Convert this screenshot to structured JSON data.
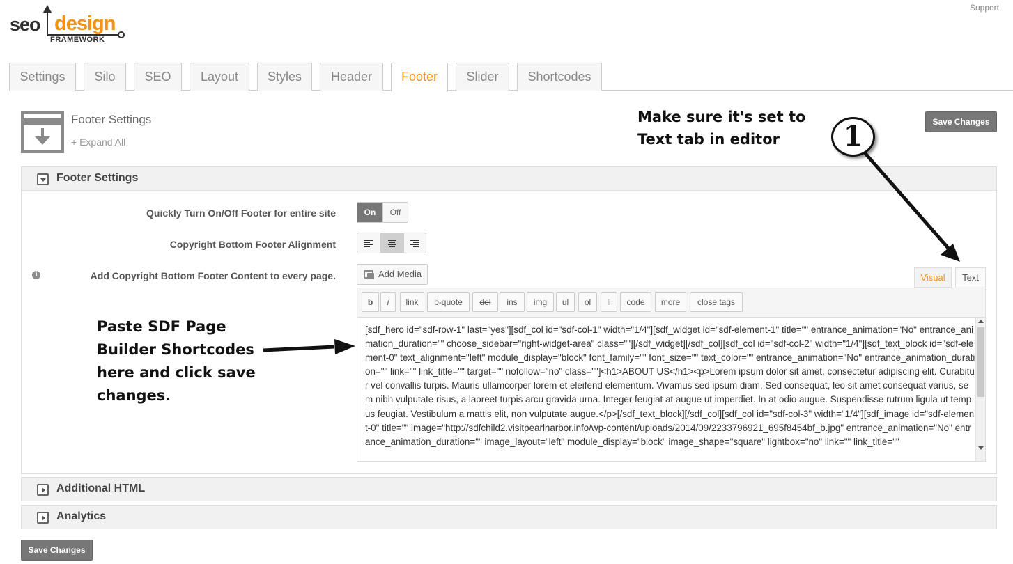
{
  "logo": {
    "seo": "seo",
    "design": "design",
    "framework": "FRAMEWORK"
  },
  "support": "Support",
  "tabs": [
    "Settings",
    "Silo",
    "SEO",
    "Layout",
    "Styles",
    "Header",
    "Footer",
    "Slider",
    "Shortcodes"
  ],
  "active_tab": "Footer",
  "page": {
    "title": "Footer Settings",
    "expand_all": "+ Expand All",
    "save_label": "Save Changes"
  },
  "panels": {
    "footer": {
      "title": "Footer Settings"
    },
    "additional_html": {
      "title": "Additional HTML"
    },
    "analytics": {
      "title": "Analytics"
    }
  },
  "fields": {
    "toggle_footer": {
      "label": "Quickly Turn On/Off Footer for entire site",
      "on": "On",
      "off": "Off",
      "value": "On"
    },
    "alignment": {
      "label": "Copyright Bottom Footer Alignment",
      "value": "center"
    },
    "content": {
      "label": "Add Copyright Bottom Footer Content to every page.",
      "info_icon": "i"
    }
  },
  "editor": {
    "add_media": "Add Media",
    "tab_visual": "Visual",
    "tab_text": "Text",
    "active_tab": "Text",
    "quicktags": [
      "b",
      "i",
      "link",
      "b-quote",
      "del",
      "ins",
      "img",
      "ul",
      "ol",
      "li",
      "code",
      "more",
      "close tags"
    ],
    "content": "[sdf_hero id=\"sdf-row-1\" last=\"yes\"][sdf_col id=\"sdf-col-1\" width=\"1/4\"][sdf_widget id=\"sdf-element-1\" title=\"\" entrance_animation=\"No\" entrance_animation_duration=\"\" choose_sidebar=\"right-widget-area\" class=\"\"][/sdf_widget][/sdf_col][sdf_col id=\"sdf-col-2\" width=\"1/4\"][sdf_text_block id=\"sdf-element-0\" text_alignment=\"left\" module_display=\"block\" font_family=\"\" font_size=\"\" text_color=\"\" entrance_animation=\"No\" entrance_animation_duration=\"\" link=\"\" link_title=\"\" target=\"\" nofollow=\"no\" class=\"\"]<h1>ABOUT US</h1><p>Lorem ipsum dolor sit amet, consectetur adipiscing elit. Curabitur vel convallis turpis. Mauris ullamcorper lorem et eleifend elementum. Vivamus sed ipsum diam. Sed consequat, leo sit amet consequat varius, sem nibh vulputate risus, a laoreet turpis arcu gravida urna. Integer feugiat at augue ut imperdiet. In at odio augue. Suspendisse rutrum ligula ut tempus feugiat. Vestibulum a mattis elit, non vulputate augue.</p>[/sdf_text_block][/sdf_col][sdf_col id=\"sdf-col-3\" width=\"1/4\"][sdf_image id=\"sdf-element-0\" title=\"\" image=\"http://sdfchild2.visitpearlharbor.info/wp-content/uploads/2014/09/2233796921_695f8454bf_b.jpg\" entrance_animation=\"No\" entrance_animation_duration=\"\" image_layout=\"left\" module_display=\"block\" image_shape=\"square\" lightbox=\"no\" link=\"\" link_title=\"\""
  },
  "annotations": {
    "step1": "Make sure it's set to Text tab in editor",
    "badge": "1",
    "paste": "Paste SDF Page Builder Shortcodes here and click save changes."
  },
  "colors": {
    "accent": "#f29216",
    "button": "#777777"
  }
}
